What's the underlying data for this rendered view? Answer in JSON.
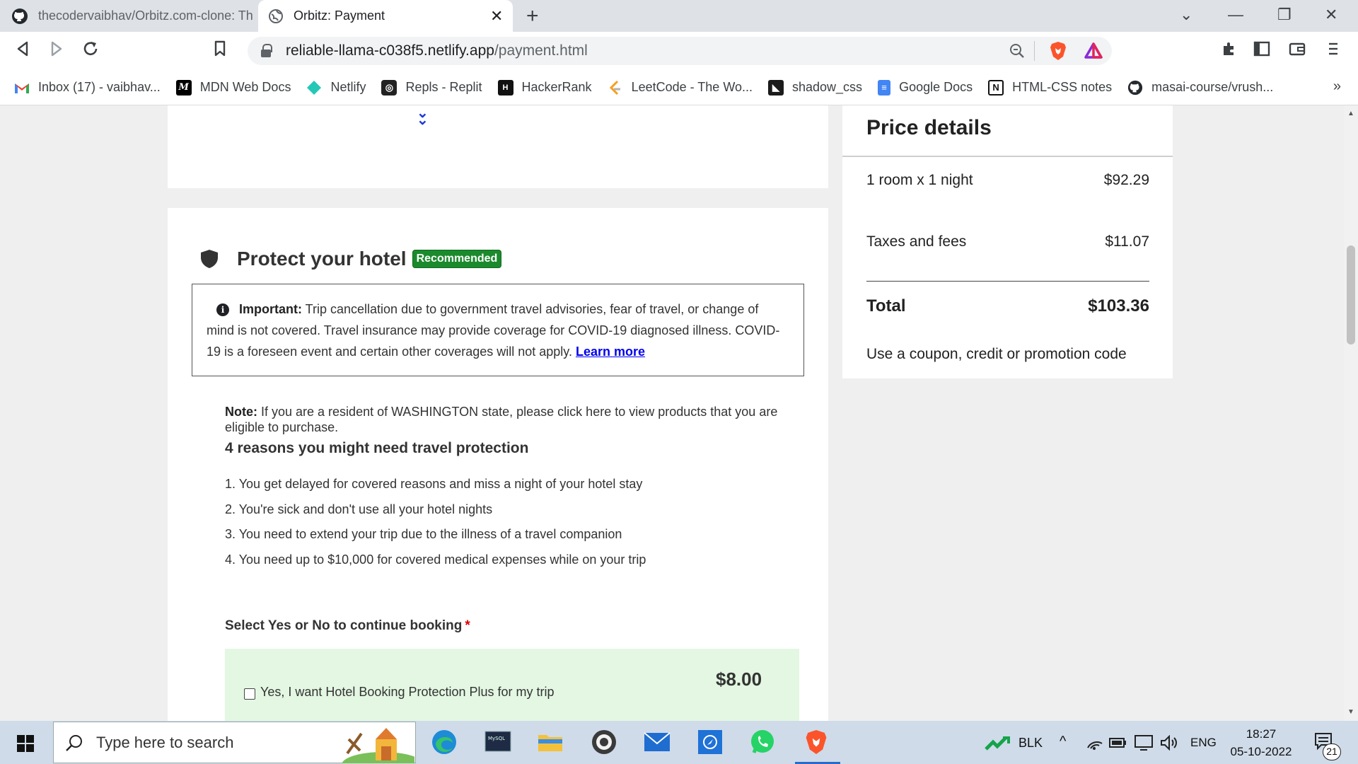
{
  "browser": {
    "tabs": [
      {
        "title": "thecodervaibhav/Orbitz.com-clone: Th",
        "active": false
      },
      {
        "title": "Orbitz: Payment",
        "active": true
      }
    ],
    "url_host": "reliable-llama-c038f5.netlify.app",
    "url_path": "/payment.html",
    "bookmarks": [
      {
        "label": "Inbox (17) - vaibhav...",
        "icon": "gmail-icon",
        "color": "#ea4335"
      },
      {
        "label": "MDN Web Docs",
        "icon": "mdn-icon",
        "color": "#000000"
      },
      {
        "label": "Netlify",
        "icon": "netlify-icon",
        "color": "#25c7b7"
      },
      {
        "label": "Repls - Replit",
        "icon": "replit-icon",
        "color": "#222222"
      },
      {
        "label": "HackerRank",
        "icon": "hackerrank-icon",
        "color": "#111111"
      },
      {
        "label": "LeetCode - The Wo...",
        "icon": "leetcode-icon",
        "color": "#f89f1b"
      },
      {
        "label": "shadow_css",
        "icon": "shadow-css-icon",
        "color": "#1b1b1b"
      },
      {
        "label": "Google Docs",
        "icon": "google-docs-icon",
        "color": "#4285f4"
      },
      {
        "label": "HTML-CSS notes",
        "icon": "notion-icon",
        "color": "#111111"
      },
      {
        "label": "masai-course/vrush...",
        "icon": "github-icon",
        "color": "#111111"
      }
    ]
  },
  "protect": {
    "title": "Protect your hotel",
    "badge": "Recommended",
    "important_label": "Important:",
    "important_text": " Trip cancellation due to government travel advisories, fear of travel, or change of mind is not covered. Travel insurance may provide coverage for COVID-19 diagnosed illness. COVID-19 is a foreseen event and certain other coverages will not apply. ",
    "learn_more": "Learn more",
    "note_label": "Note:",
    "note_text": " If you are a resident of WASHINGTON state, please click here to view products that you are eligible to purchase.",
    "reasons_title": "4 reasons you might need travel protection",
    "reasons": [
      "1. You get delayed for covered reasons and miss a night of your hotel stay",
      "2. You're sick and don't use all your hotel nights",
      "3. You need to extend your trip due to the illness of a travel companion",
      "4. You need up to $10,000 for covered medical expenses while on your trip"
    ],
    "select_label": "Select Yes or No to continue booking",
    "required_mark": "*",
    "yes_option": "Yes, I want Hotel Booking Protection Plus for my trip",
    "yes_price": "$8.00"
  },
  "price_details": {
    "title": "Price details",
    "room_label": "1 room x 1 night",
    "room_price": "$92.29",
    "taxes_label": "Taxes and fees",
    "taxes_price": "$11.07",
    "total_label": "Total",
    "total_price": "$103.36",
    "coupon_text": "Use a coupon, credit or promotion code"
  },
  "taskbar": {
    "search_placeholder": "Type here to search",
    "stock_label": "BLK",
    "language": "ENG",
    "time": "18:27",
    "date": "05-10-2022",
    "notification_count": "21"
  },
  "colors": {
    "badge_green": "#1b8a2c",
    "link_blue": "#0000ee",
    "protection_bg": "#e3f7e3",
    "page_bg": "#efefef"
  }
}
